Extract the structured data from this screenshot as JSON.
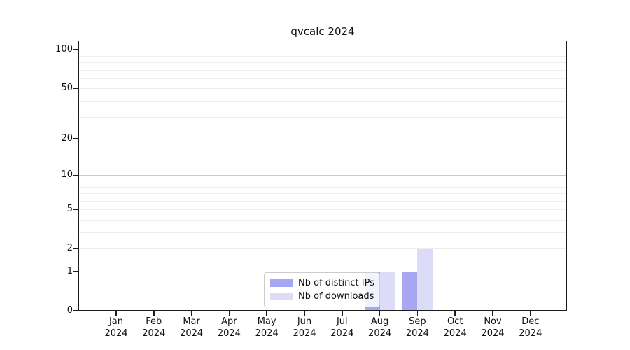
{
  "chart_data": {
    "type": "bar",
    "title": "qvcalc 2024",
    "categories": [
      "Jan",
      "Feb",
      "Mar",
      "Apr",
      "May",
      "Jun",
      "Jul",
      "Aug",
      "Sep",
      "Oct",
      "Nov",
      "Dec"
    ],
    "category_year": "2024",
    "series": [
      {
        "name": "Nb of distinct IPs",
        "color": "#a6a6f2",
        "values": [
          0,
          0,
          0,
          0,
          0,
          0,
          0,
          1,
          1,
          0,
          0,
          0
        ]
      },
      {
        "name": "Nb of downloads",
        "color": "#dcdcf8",
        "values": [
          0,
          0,
          0,
          0,
          0,
          0,
          0,
          1,
          2,
          0,
          0,
          0
        ]
      }
    ],
    "y_axis": {
      "scale": "log1p",
      "tick_labels": [
        0,
        1,
        2,
        5,
        10,
        20,
        50,
        100
      ],
      "major_gridlines": [
        1,
        10,
        100
      ],
      "minor_gridlines": [
        2,
        3,
        4,
        5,
        6,
        7,
        8,
        9,
        20,
        30,
        40,
        50,
        60,
        70,
        80,
        90
      ],
      "top_value": 118
    },
    "x_axis": {
      "tick_count": 12
    },
    "legend": {
      "position": "lower center"
    },
    "grid": true
  },
  "colors": {
    "background": "#ffffff",
    "major_grid": "#c9c9c9",
    "minor_grid": "#ededed",
    "spine": "#1c1c1c",
    "text": "#111111",
    "legend_border": "#cccccc"
  }
}
